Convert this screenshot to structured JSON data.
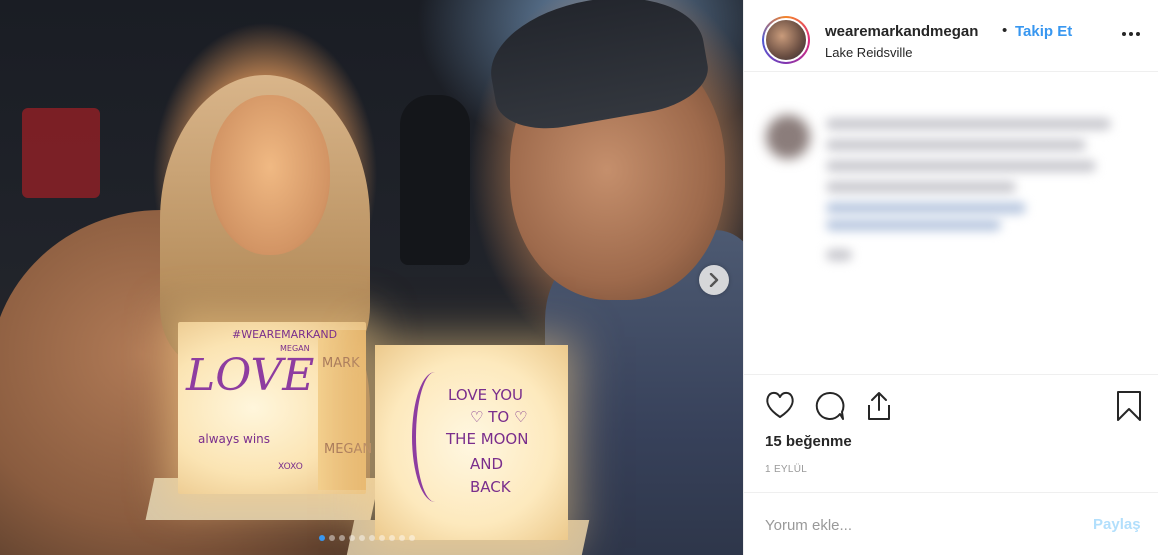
{
  "photo": {
    "alt_carousel_count": 8,
    "active_index": 0,
    "lantern_left": {
      "hashtag": "#WEAREMARKAND",
      "hashtag2": "MEGAN",
      "word": "LOVE",
      "subtext": "always wins",
      "signoff": "XOXO",
      "side_top": "MARK",
      "side_bottom": "MEGAN"
    },
    "lantern_right": {
      "line1": "LOVE YOU",
      "line2": "♡ TO ♡",
      "line3": "THE MOON",
      "line4": "AND",
      "line5": "BACK"
    },
    "next_icon": "chevron-right-icon"
  },
  "header": {
    "username": "wearemarkandmegan",
    "separator": "•",
    "follow_label": "Takip Et",
    "location": "Lake Reidsville",
    "more_icon": "more-horizontal-icon"
  },
  "actions": {
    "like_icon": "heart-icon",
    "comment_icon": "comment-bubble-icon",
    "share_icon": "share-icon",
    "save_icon": "bookmark-icon",
    "likes_text": "15 beğenme",
    "date_text": "1 EYLÜL"
  },
  "comment_box": {
    "placeholder": "Yorum ekle...",
    "post_label": "Paylaş"
  },
  "colors": {
    "accent": "#3897f0",
    "post_disabled": "#b2dffc",
    "text": "#262626",
    "muted": "#999999",
    "border": "#efefef"
  }
}
